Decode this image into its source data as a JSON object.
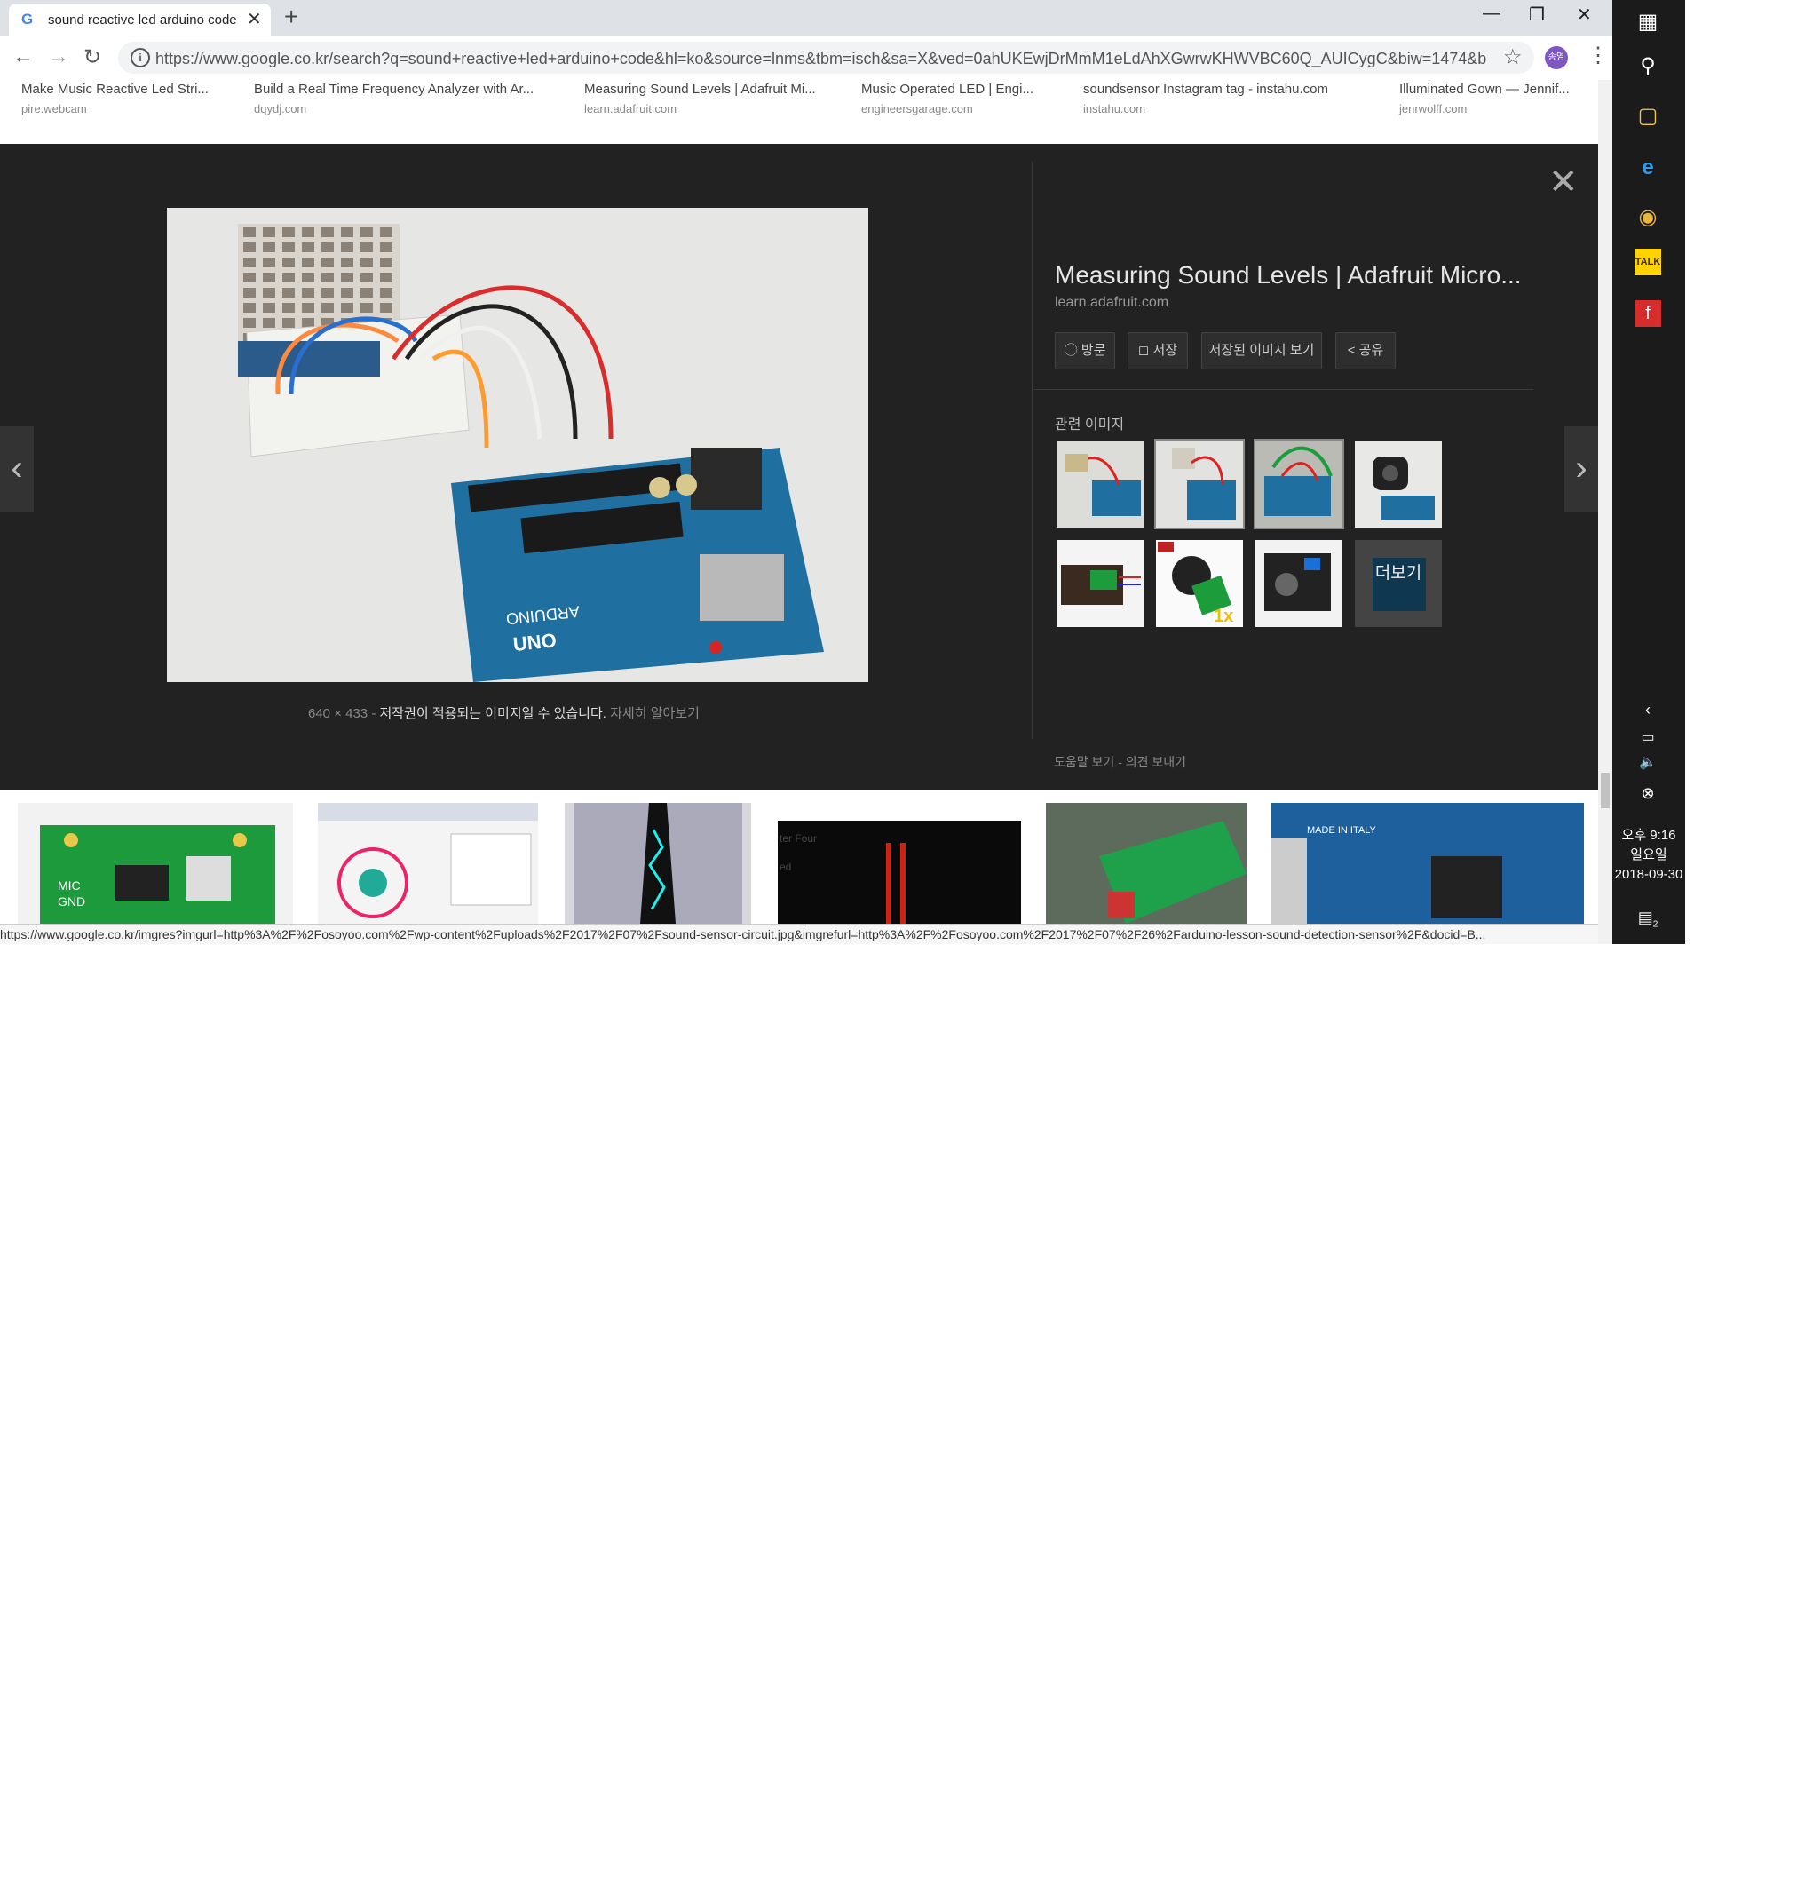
{
  "browser": {
    "tab_title": "sound reactive led arduino code",
    "tab_close": "✕",
    "new_tab": "+",
    "url": "https://www.google.co.kr/search?q=sound+reactive+led+arduino+code&hl=ko&source=lnms&tbm=isch&sa=X&ved=0ahUKEwjDrMmM1eLdAhXGwrwKHWVBC60Q_AUICygC&biw=1474&b...",
    "profile": "송영",
    "status_url": "https://www.google.co.kr/imgres?imgurl=http%3A%2F%2Fosoyoo.com%2Fwp-content%2Fuploads%2F2017%2F07%2Fsound-sensor-circuit.jpg&imgrefurl=http%3A%2F%2Fosoyoo.com%2F2017%2F07%2F26%2Farduino-lesson-sound-detection-sensor%2F&docid=B..."
  },
  "strip": [
    {
      "title": "Make Music Reactive Led Stri...",
      "domain": "pire.webcam"
    },
    {
      "title": "Build a Real Time Frequency Analyzer with Ar...",
      "domain": "dqydj.com"
    },
    {
      "title": "Measuring Sound Levels | Adafruit Mi...",
      "domain": "learn.adafruit.com"
    },
    {
      "title": "Music Operated LED | Engi...",
      "domain": "engineersgarage.com"
    },
    {
      "title": "soundsensor Instagram tag - instahu.com",
      "domain": "instahu.com"
    },
    {
      "title": "Illuminated Gown — Jennif...",
      "domain": "jenrwolff.com"
    }
  ],
  "preview": {
    "title": "Measuring Sound Levels | Adafruit Micro...",
    "domain": "learn.adafruit.com",
    "actions": [
      "방문",
      "저장",
      "저장된 이미지 보기",
      "공유"
    ],
    "related_title": "관련 이미지",
    "more_label": "더보기",
    "image_size": "640 × 433",
    "sep": "-",
    "copyright": "저작권이 적용되는 이미지일 수 있습니다.",
    "learn_more": "자세히 알아보기",
    "help": "도움말 보기",
    "feedback": "의견 보내기"
  },
  "image_text": {
    "arduino": "ARDUINO",
    "uno": "UNO"
  },
  "grid_text": {
    "mic": "MIC",
    "gnd": "GND",
    "ter_four": "ter Four",
    "ed": "ed",
    "made_in_italy": "MADE IN ITALY"
  },
  "taskbar": {
    "kakao": "TALK",
    "time_ampm": "오후 9:16",
    "weekday": "일요일",
    "date": "2018-09-30",
    "notifications": "2"
  },
  "colors": {
    "panel_bg": "#222222",
    "arduino_blue": "#1f6fa0",
    "taskbar": "#1b1b1b"
  },
  "icons": [
    "google-icon",
    "back-icon",
    "forward-icon",
    "reload-icon",
    "info-icon",
    "star-icon",
    "menu-icon",
    "globe-icon",
    "bookmark-icon",
    "share-icon",
    "close-icon",
    "chevron-left-icon",
    "chevron-right-icon",
    "windows-icon",
    "search-icon",
    "folder-icon",
    "ie-icon",
    "chrome-icon",
    "kakaotalk-icon",
    "flash-icon",
    "notification-icon"
  ]
}
